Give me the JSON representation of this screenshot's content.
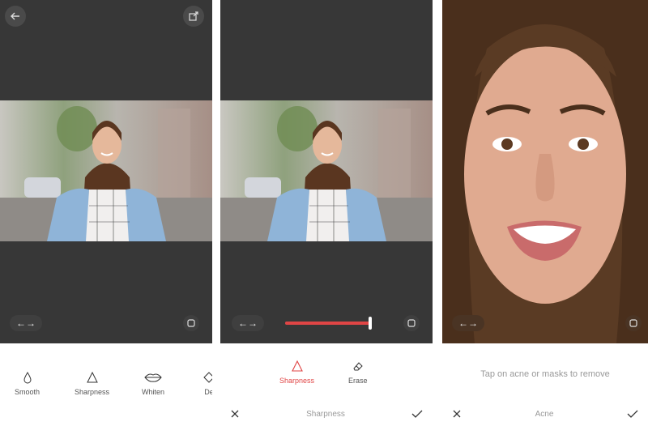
{
  "panel1": {
    "back_icon": "arrow-left-icon",
    "share_icon": "external-edit-icon",
    "compare_label": "←→",
    "tools": [
      {
        "label": "Smooth",
        "icon": "droplet-icon"
      },
      {
        "label": "Sharpness",
        "icon": "triangle-icon"
      },
      {
        "label": "Whiten",
        "icon": "lips-icon"
      },
      {
        "label": "De",
        "icon": "diamond-icon"
      }
    ]
  },
  "panel2": {
    "compare_label": "←→",
    "slider_level": 1.0,
    "tools": [
      {
        "label": "Sharpness",
        "icon": "triangle-icon",
        "active": true
      },
      {
        "label": "Erase",
        "icon": "eraser-icon",
        "active": false
      }
    ],
    "bottom": {
      "title": "Sharpness",
      "cancel_icon": "close-icon",
      "confirm_icon": "check-icon"
    }
  },
  "panel3": {
    "compare_label": "←→",
    "hint": "Tap on acne or masks to remove",
    "bottom": {
      "title": "Acne",
      "cancel_icon": "close-icon",
      "confirm_icon": "check-icon"
    }
  },
  "colors": {
    "accent": "#e04545",
    "viewer": "#373737"
  }
}
